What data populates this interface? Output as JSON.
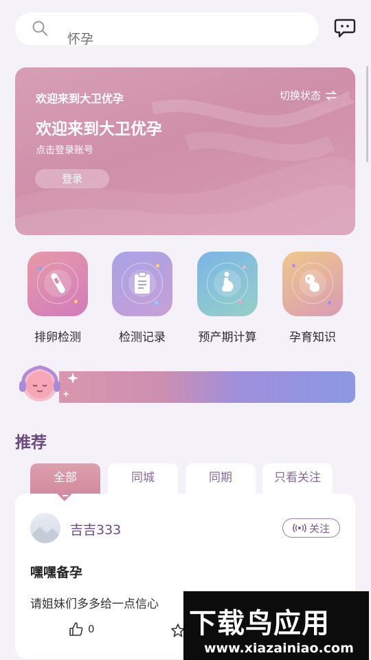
{
  "search": {
    "icon": "search-icon",
    "text": "怀孕"
  },
  "header": {
    "message_icon": "chat-bubble-icon"
  },
  "banner": {
    "small_title": "欢迎来到大卫优孕",
    "switch_label": "切换状态",
    "switch_icon": "swap-arrows-icon",
    "title": "欢迎来到大卫优孕",
    "subtitle": "点击登录账号",
    "login_label": "登录"
  },
  "features": [
    {
      "label": "排卵检测",
      "icon": "ovulation-test-icon"
    },
    {
      "label": "检测记录",
      "icon": "clipboard-icon"
    },
    {
      "label": "预产期计算",
      "icon": "pregnant-woman-icon"
    },
    {
      "label": "孕育知识",
      "icon": "fetus-icon"
    }
  ],
  "section": {
    "title": "推荐",
    "tabs": [
      {
        "label": "全部",
        "active": true
      },
      {
        "label": "同城",
        "active": false
      },
      {
        "label": "同期",
        "active": false
      },
      {
        "label": "只看关注",
        "active": false
      }
    ]
  },
  "post": {
    "username": "吉吉333",
    "follow_label": "关注",
    "title": "嘿嘿备孕",
    "body": "请姐妹们多多给一点信心",
    "like_count": "0"
  },
  "watermark": {
    "big": "下载鸟应用",
    "small": "www.xiazainiao.com"
  },
  "colors": {
    "accent": "#d48aa0",
    "purple_text": "#6c4a7e",
    "bg": "#f4f1f8"
  }
}
